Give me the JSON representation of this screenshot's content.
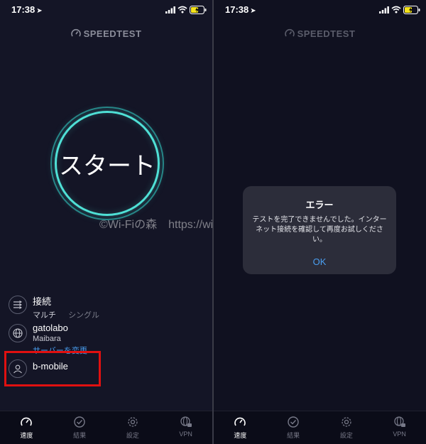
{
  "left": {
    "status_time": "17:38",
    "logo": "SPEEDTEST",
    "start_label": "スタート",
    "watermark": "©Wi-Fiの森　https://wifi",
    "connection": {
      "title": "接続",
      "option_selected": "マルチ",
      "option_other": "シングル"
    },
    "server": {
      "title": "gatolabo",
      "location": "Maibara",
      "change_link": "サーバーを変更"
    },
    "provider": {
      "title": "b-mobile"
    },
    "tabs": [
      {
        "label": "速度",
        "icon": "speed-gauge-icon"
      },
      {
        "label": "結果",
        "icon": "check-circle-icon"
      },
      {
        "label": "設定",
        "icon": "gear-icon"
      },
      {
        "label": "VPN",
        "icon": "globe-lock-icon"
      }
    ]
  },
  "right": {
    "status_time": "17:38",
    "logo": "SPEEDTEST",
    "dialog": {
      "title": "エラー",
      "message": "テストを完了できませんでした。インターネット接続を確認して再度お試しください。",
      "ok_label": "OK"
    },
    "tabs": [
      {
        "label": "速度",
        "icon": "speed-gauge-icon"
      },
      {
        "label": "結果",
        "icon": "check-circle-icon"
      },
      {
        "label": "設定",
        "icon": "gear-icon"
      },
      {
        "label": "VPN",
        "icon": "globe-lock-icon"
      }
    ]
  },
  "colors": {
    "accent": "#4fe0d6",
    "link": "#4a9ef0",
    "highlight": "#e01010",
    "battery": "#f5e41a"
  }
}
